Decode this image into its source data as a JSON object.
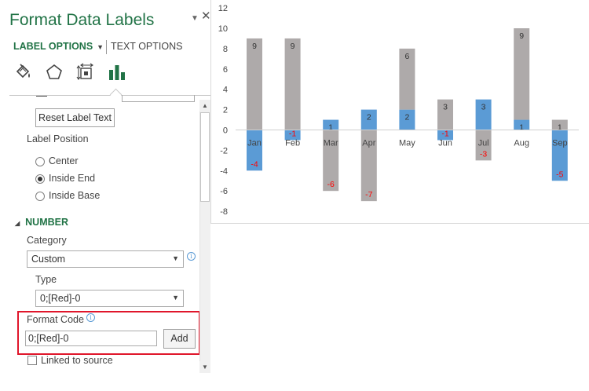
{
  "pane": {
    "title": "Format Data Labels",
    "pin_icon": "dropdown-triangle",
    "close_icon": "close-x",
    "tabs": {
      "label_options": "LABEL OPTIONS",
      "text_options": "TEXT OPTIONS"
    },
    "category_icons": [
      "fill-line-icon",
      "effects-icon",
      "size-properties-icon",
      "label-options-icon"
    ],
    "reset_button": "Reset Label Text",
    "label_position": {
      "title": "Label Position",
      "options": [
        "Center",
        "Inside End",
        "Inside Base"
      ],
      "selected": "Inside End"
    },
    "number": {
      "header": "NUMBER",
      "category_label": "Category",
      "category_value": "Custom",
      "type_label": "Type",
      "type_value": "0;[Red]-0",
      "format_code_label": "Format Code",
      "format_code_value": "0;[Red]-0",
      "add_button": "Add",
      "linked_label": "Linked to source",
      "linked_checked": false
    },
    "colors": {
      "accent": "#217346",
      "highlight": "#e0162b",
      "info": "#5b9bd5"
    }
  },
  "chart_data": {
    "type": "bar",
    "categories": [
      "Jan",
      "Feb",
      "Mar",
      "Apr",
      "May",
      "Jun",
      "Jul",
      "Aug",
      "Sep"
    ],
    "series": [
      {
        "values": [
          -4,
          -1,
          1,
          2,
          2,
          -1,
          3,
          1,
          -5
        ],
        "color": "#5b9bd5"
      },
      {
        "values": [
          9,
          9,
          -6,
          -7,
          6,
          3,
          -3,
          9,
          1
        ],
        "color": "#aeaaaa"
      }
    ],
    "negative_label_color": "#ff0000",
    "yticks": [
      12,
      10,
      8,
      6,
      4,
      2,
      0,
      -2,
      -4,
      -6,
      -8
    ],
    "ylim": [
      -8,
      12
    ],
    "grid": false,
    "legend": "none",
    "title": "",
    "xlabel": "",
    "ylabel": ""
  }
}
